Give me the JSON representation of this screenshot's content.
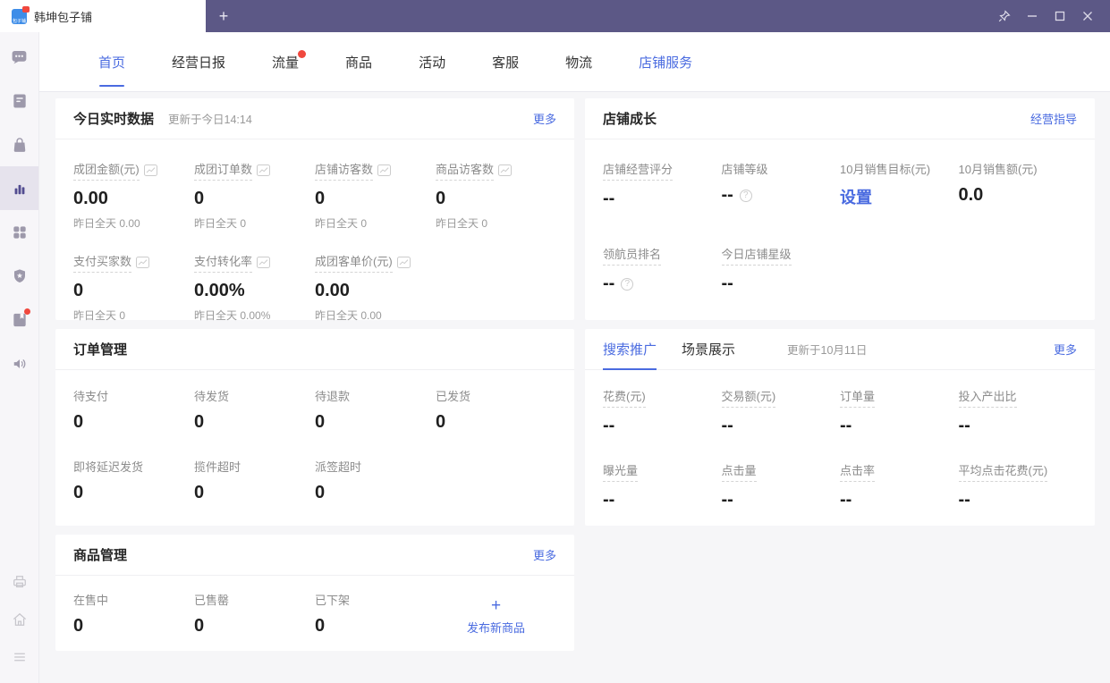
{
  "window": {
    "tab_title": "韩坤包子铺",
    "favicon_text": "包子铺",
    "new_tab_label": "+"
  },
  "colors": {
    "titlebar_purple": "#5c5886",
    "accent_blue": "#4a6be0",
    "badge_red": "#f0483e",
    "active_icon_purple": "#524c90"
  },
  "nav": {
    "items": [
      {
        "label": "首页"
      },
      {
        "label": "经营日报"
      },
      {
        "label": "流量"
      },
      {
        "label": "商品"
      },
      {
        "label": "活动"
      },
      {
        "label": "客服"
      },
      {
        "label": "物流"
      },
      {
        "label": "店铺服务"
      }
    ]
  },
  "icons": {
    "help": "?"
  },
  "realtime_card": {
    "title": "今日实时数据",
    "updated": "更新于今日14:14",
    "more": "更多",
    "row1": [
      {
        "label": "成团金额(元)",
        "value": "0.00",
        "sub": "昨日全天 0.00"
      },
      {
        "label": "成团订单数",
        "value": "0",
        "sub": "昨日全天 0"
      },
      {
        "label": "店铺访客数",
        "value": "0",
        "sub": "昨日全天 0"
      },
      {
        "label": "商品访客数",
        "value": "0",
        "sub": "昨日全天 0"
      }
    ],
    "row2": [
      {
        "label": "支付买家数",
        "value": "0",
        "sub": "昨日全天 0"
      },
      {
        "label": "支付转化率",
        "value": "0.00%",
        "sub": "昨日全天 0.00%"
      },
      {
        "label": "成团客单价(元)",
        "value": "0.00",
        "sub": "昨日全天 0.00"
      }
    ]
  },
  "growth_card": {
    "title": "店铺成长",
    "link": "经营指导",
    "row1": [
      {
        "label": "店铺经营评分",
        "value": "--"
      },
      {
        "label": "店铺等级",
        "value": "--"
      },
      {
        "label": "10月销售目标(元)",
        "value": "设置"
      },
      {
        "label": "10月销售额(元)",
        "value": "0.0"
      }
    ],
    "row2": [
      {
        "label": "领航员排名",
        "value": "--"
      },
      {
        "label": "今日店铺星级",
        "value": "--"
      }
    ]
  },
  "orders_card": {
    "title": "订单管理",
    "row1": [
      {
        "label": "待支付",
        "value": "0"
      },
      {
        "label": "待发货",
        "value": "0"
      },
      {
        "label": "待退款",
        "value": "0"
      },
      {
        "label": "已发货",
        "value": "0"
      }
    ],
    "row2": [
      {
        "label": "即将延迟发货",
        "value": "0"
      },
      {
        "label": "揽件超时",
        "value": "0"
      },
      {
        "label": "派签超时",
        "value": "0"
      }
    ]
  },
  "promo_card": {
    "tabs": [
      {
        "label": "搜索推广"
      },
      {
        "label": "场景展示"
      }
    ],
    "updated": "更新于10月11日",
    "more": "更多",
    "row1": [
      {
        "label": "花费(元)",
        "value": "--"
      },
      {
        "label": "交易额(元)",
        "value": "--"
      },
      {
        "label": "订单量",
        "value": "--"
      },
      {
        "label": "投入产出比",
        "value": "--"
      }
    ],
    "row2": [
      {
        "label": "曝光量",
        "value": "--"
      },
      {
        "label": "点击量",
        "value": "--"
      },
      {
        "label": "点击率",
        "value": "--"
      },
      {
        "label": "平均点击花费(元)",
        "value": "--"
      }
    ]
  },
  "goods_card": {
    "title": "商品管理",
    "more": "更多",
    "metrics": [
      {
        "label": "在售中",
        "value": "0"
      },
      {
        "label": "已售罄",
        "value": "0"
      },
      {
        "label": "已下架",
        "value": "0"
      }
    ],
    "publish": {
      "plus": "+",
      "label": "发布新商品"
    }
  }
}
